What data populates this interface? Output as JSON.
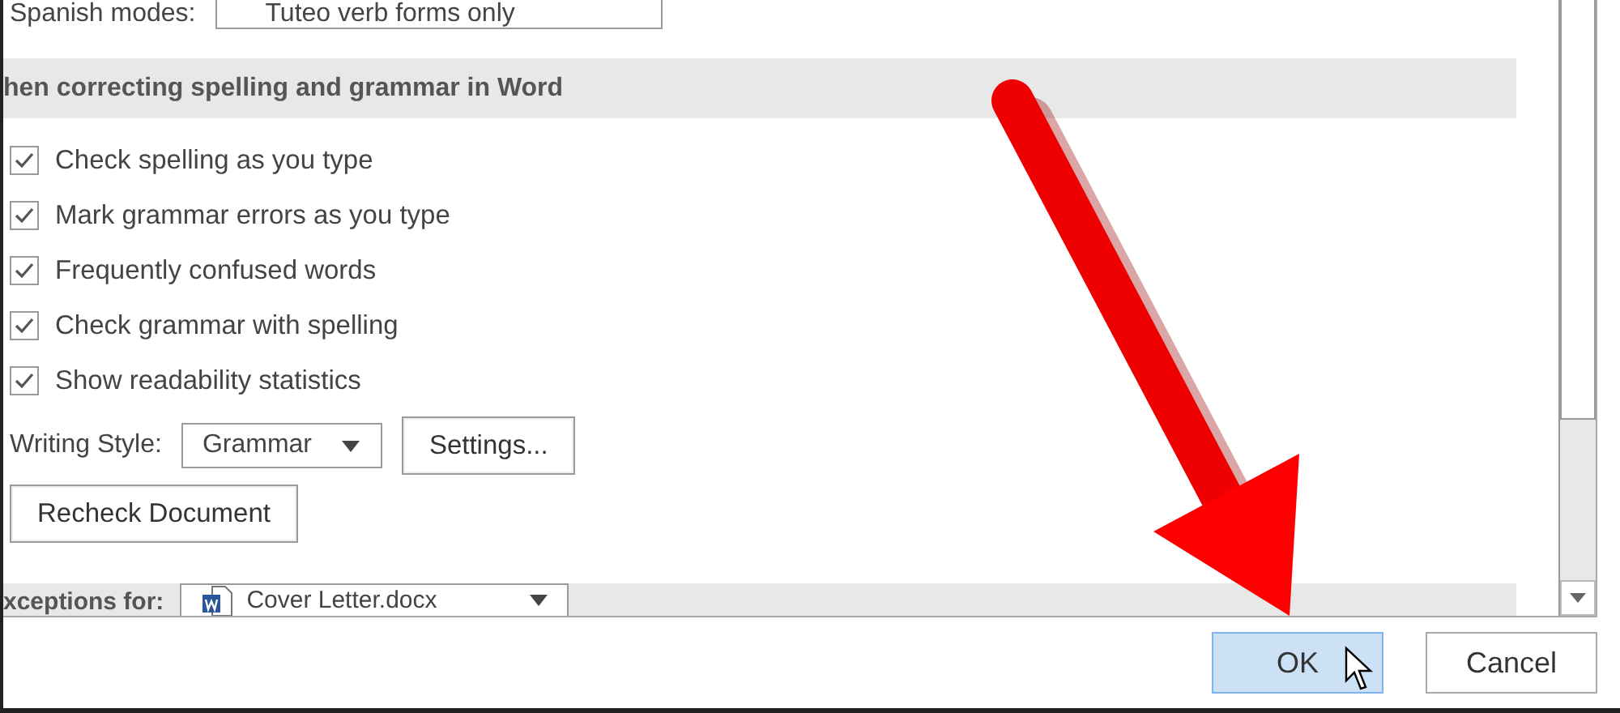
{
  "spanish_modes": {
    "label": "Spanish modes:",
    "value": "Tuteo verb forms only"
  },
  "section_heading": "hen correcting spelling and grammar in Word",
  "options": [
    {
      "label": "Check spelling as you type",
      "checked": true
    },
    {
      "label": "Mark grammar errors as you type",
      "checked": true
    },
    {
      "label": "Frequently confused words",
      "checked": true
    },
    {
      "label": "Check grammar with spelling",
      "checked": true
    },
    {
      "label": "Show readability statistics",
      "checked": true
    }
  ],
  "writing_style": {
    "label": "Writing Style:",
    "value": "Grammar"
  },
  "settings_button": "Settings...",
  "recheck_button": "Recheck Document",
  "exceptions": {
    "label": "xceptions for:",
    "value": "Cover Letter.docx"
  },
  "buttons": [
    {
      "label": "OK",
      "hovered": true
    },
    {
      "label": "Cancel",
      "hovered": false
    }
  ]
}
